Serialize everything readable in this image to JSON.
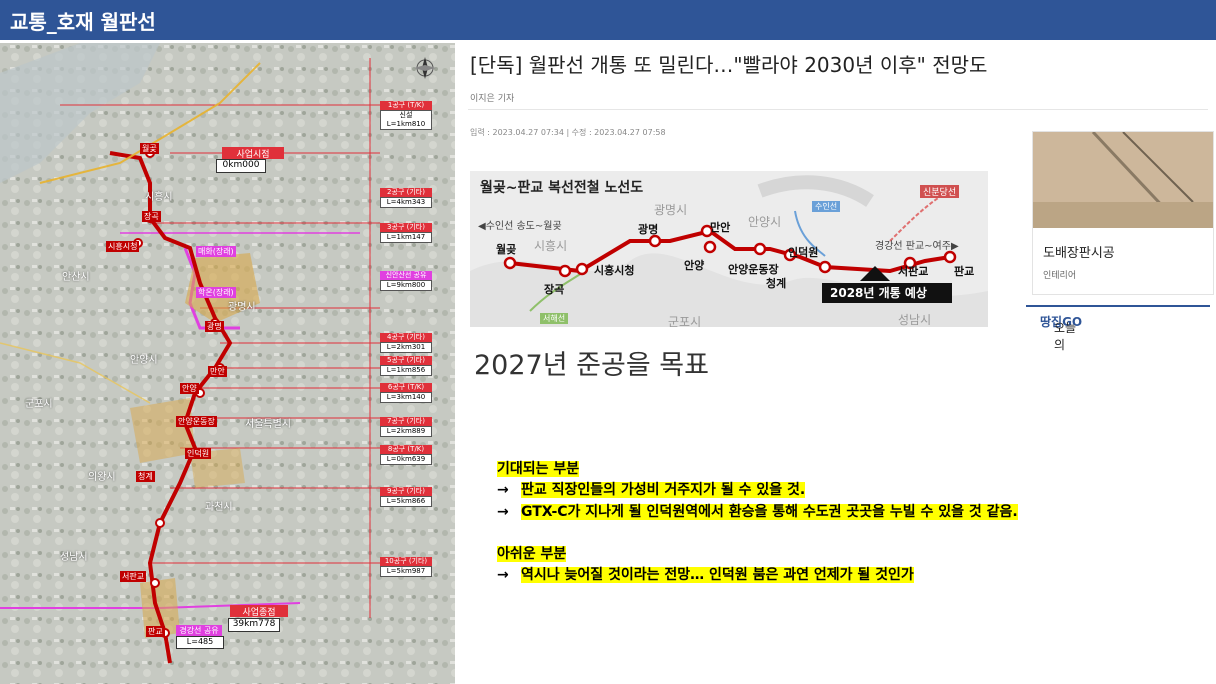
{
  "slide_title": "교통_호재 월판선",
  "article": {
    "headline": "[단독] 월판선 개통 또 밀린다…\"빨라야 2030년 이후\" 전망도",
    "reporter": "이지은 기자",
    "meta": "입력 : 2023.04.27 07:34  |  수정 : 2023.04.27 07:58",
    "subheading": "2027년 준공을 목표",
    "side_card": {
      "title": "도배장판시공",
      "category": "인테리어"
    },
    "today_prefix": "오늘의 ",
    "today_highlight": "땅집GO"
  },
  "route_map": {
    "title": "월곶~판교 복선전철 노선도",
    "left_line": "◀수인선 송도~월곶",
    "right_line": "경강선 판교~여주▶",
    "sinbundang": "신분당선",
    "suin_top": "수인선",
    "suin_bottom": "서해선",
    "callout": "2028년 개통 예상",
    "districts": [
      "광명시",
      "안양시",
      "시흥시",
      "군포시",
      "성남시"
    ],
    "stations": [
      "월곶",
      "장곡",
      "시흥시청",
      "광명",
      "만안",
      "안양",
      "안양운동장",
      "인덕원",
      "청계",
      "서판교",
      "판교"
    ]
  },
  "map_labels": {
    "start": "사업시점",
    "start_km": "0km000",
    "end": "사업종점",
    "end_km": "39km778",
    "gyeonggang": "경강선 공유",
    "gyeonggang_len": "L=485",
    "cities": [
      "시흥시",
      "안산시",
      "광명시",
      "안양시",
      "군포시",
      "의왕시",
      "서울특별시",
      "과천시",
      "성남시"
    ],
    "stations": [
      "월곶",
      "장곡",
      "시흥시청",
      "매화(장래)",
      "학온(장래)",
      "광명",
      "만안",
      "안양",
      "안양운동장",
      "인덕원",
      "청계",
      "서판교",
      "판교"
    ],
    "sections": [
      {
        "name": "1공구 (T/K)",
        "len": "신설 L=1km810"
      },
      {
        "name": "2공구 (기타)",
        "len": "L=4km343"
      },
      {
        "name": "3공구 (기타)",
        "len": "L=1km147"
      },
      {
        "name": "신안산선 공유",
        "len": "L=9km800"
      },
      {
        "name": "4공구 (기타)",
        "len": "L=2km301"
      },
      {
        "name": "5공구 (기타)",
        "len": "L=1km856"
      },
      {
        "name": "6공구 (T/K)",
        "len": "L=3km140"
      },
      {
        "name": "7공구 (기타)",
        "len": "L=2km889"
      },
      {
        "name": "8공구 (T/K)",
        "len": "L=0km639"
      },
      {
        "name": "9공구 (기타)",
        "len": "L=5km866"
      },
      {
        "name": "10공구 (기타)",
        "len": "L=5km987"
      }
    ]
  },
  "notes": {
    "expected_heading": "기대되는 부분",
    "expected_items": [
      "판교 직장인들의 가성비 거주지가 될 수 있을 것.",
      "GTX-C가 지나게 될 인덕원역에서 환승을 통해 수도권 곳곳을 누빌 수 있을 것 같음."
    ],
    "regret_heading": "아쉬운 부분",
    "regret_items": [
      "역시나 늦어질 것이라는 전망… 인덕원 붐은 과연 언제가 될 것인가"
    ],
    "arrow": "→"
  },
  "colors": {
    "title_bar": "#2f5597",
    "route": "#c00000",
    "highlight": "#ffff00",
    "shared_line": "#e040e0"
  }
}
